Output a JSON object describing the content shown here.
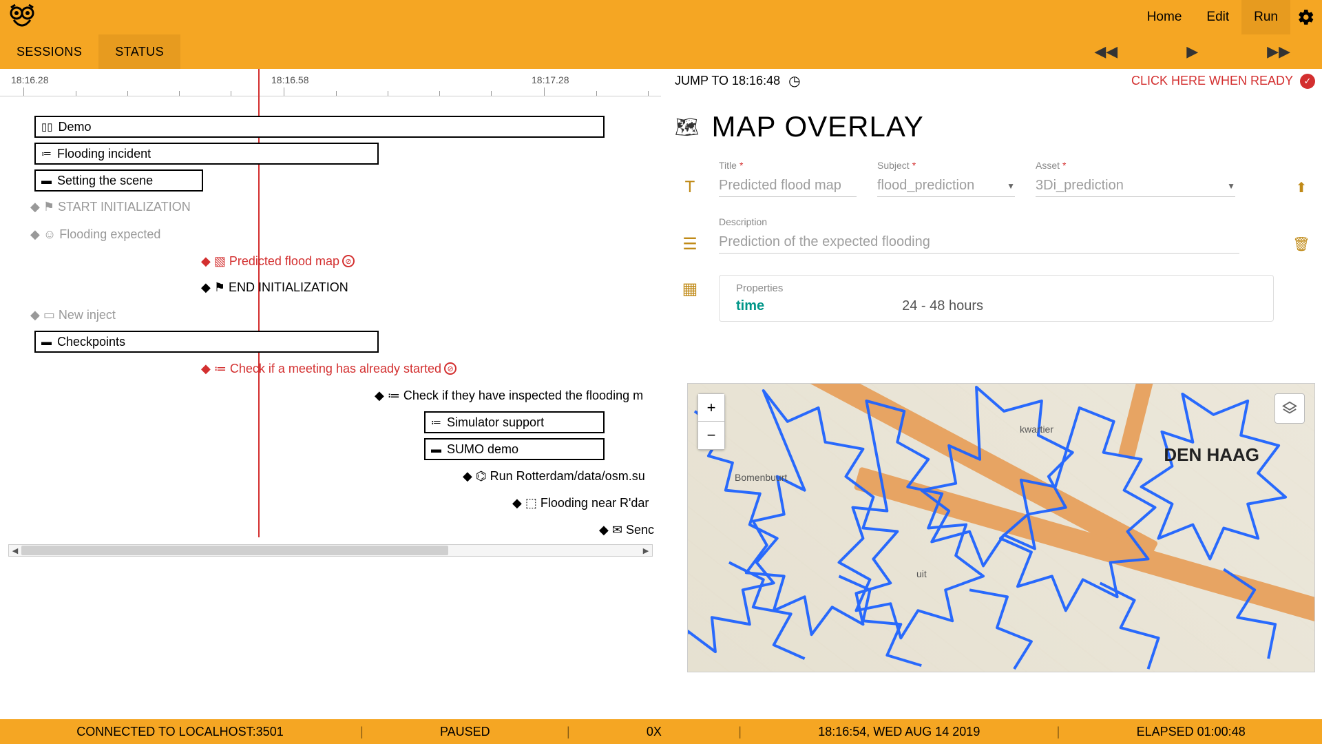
{
  "nav": {
    "home": "Home",
    "edit": "Edit",
    "run": "Run"
  },
  "tabs": {
    "sessions": "SESSIONS",
    "status": "STATUS"
  },
  "axis": {
    "t1": "18:16.28",
    "t2": "18:16.58",
    "t3": "18:17.28"
  },
  "gantt": {
    "demo": "Demo",
    "flooding_incident": "Flooding incident",
    "setting_scene": "Setting the scene",
    "start_init": "START INITIALIZATION",
    "flood_expected": "Flooding expected",
    "pred_flood_map": "Predicted flood map",
    "end_init": "END INITIALIZATION",
    "new_inject": "New inject",
    "checkpoints": "Checkpoints",
    "check_meeting": "Check if a meeting has already started",
    "check_inspect": "Check if they have inspected the flooding m",
    "sim_support": "Simulator support",
    "sumo_demo": "SUMO demo",
    "run_rott": "Run Rotterdam/data/osm.su",
    "flood_near_rdam": "Flooding near R'dar",
    "send": "Senc"
  },
  "jump": {
    "label": "JUMP TO 18:16:48"
  },
  "ready": {
    "label": "CLICK HERE WHEN READY"
  },
  "panel": {
    "title": "MAP OVERLAY"
  },
  "form": {
    "title_lab": "Title",
    "title_val": "Predicted flood map",
    "subject_lab": "Subject",
    "subject_val": "flood_prediction",
    "asset_lab": "Asset",
    "asset_val": "3Di_prediction",
    "desc_lab": "Description",
    "desc_val": "Prediction of the expected flooding"
  },
  "props": {
    "label": "Properties",
    "key": "time",
    "val": "24 - 48 hours"
  },
  "map": {
    "city": "DEN HAAG",
    "d1": "Bomenbuurt",
    "d2": "kwartier",
    "d3": "uit"
  },
  "status": {
    "conn": "CONNECTED TO LOCALHOST:3501",
    "state": "PAUSED",
    "speed": "0X",
    "time": "18:16:54, WED AUG 14 2019",
    "elapsed": "ELAPSED 01:00:48"
  }
}
